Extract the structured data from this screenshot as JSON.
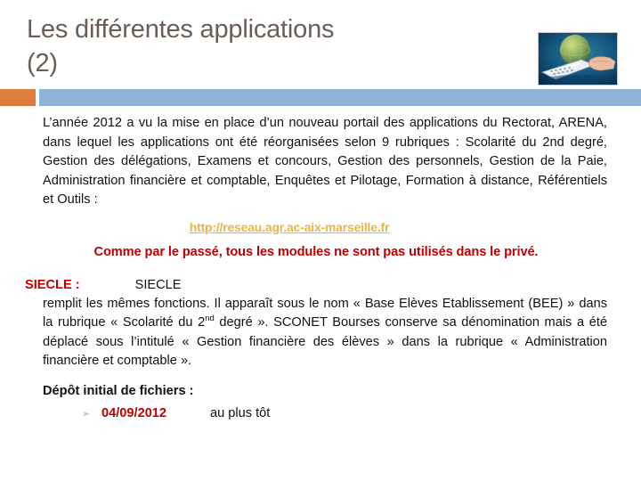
{
  "header": {
    "title": "Les différentes applications\n(2)",
    "thumbnail_alt": "globe-keyboard-hand-image",
    "accent_orange": "#de7c3d",
    "accent_blue": "#8fb4d6",
    "title_color": "#6b5d55"
  },
  "body": {
    "paragraph_1": "L’année 2012 a vu la mise en place d’un nouveau portail des applications du Rectorat, ARENA, dans lequel les applications ont été réorganisées selon 9 rubriques :  Scolarité du 2nd degré, Gestion des délégations, Examens et concours, Gestion des personnels, Gestion de la Paie, Administration financière et comptable, Enquêtes et Pilotage, Formation à distance, Référentiels et Outils :",
    "url": "http://reseau.agr.ac-aix-marseille.fr",
    "url_color": "#e8b647",
    "red_note": "Comme par le passé, tous les modules ne sont pas utilisés dans le privé.",
    "red_color": "#c00000",
    "siecle": {
      "label": "SIECLE :",
      "name": "SIECLE",
      "text_before_sup": "remplit les mêmes fonctions. Il apparaît sous le nom « Base Elèves Etablissement (BEE) » dans la rubrique « Scolarité du 2",
      "superscript": "nd",
      "text_after_sup": " degré ». SCONET Bourses conserve sa dénomination mais a été déplacé sous l’intitulé « Gestion financière des élèves » dans la rubrique « Administration financière et comptable »."
    },
    "depot": {
      "heading": "Dépôt initial de fichiers :",
      "bullet_icon": "chevron-right-bullet",
      "bullet_glyph": "➢",
      "date": "04/09/2012",
      "note": "au plus tôt"
    }
  }
}
